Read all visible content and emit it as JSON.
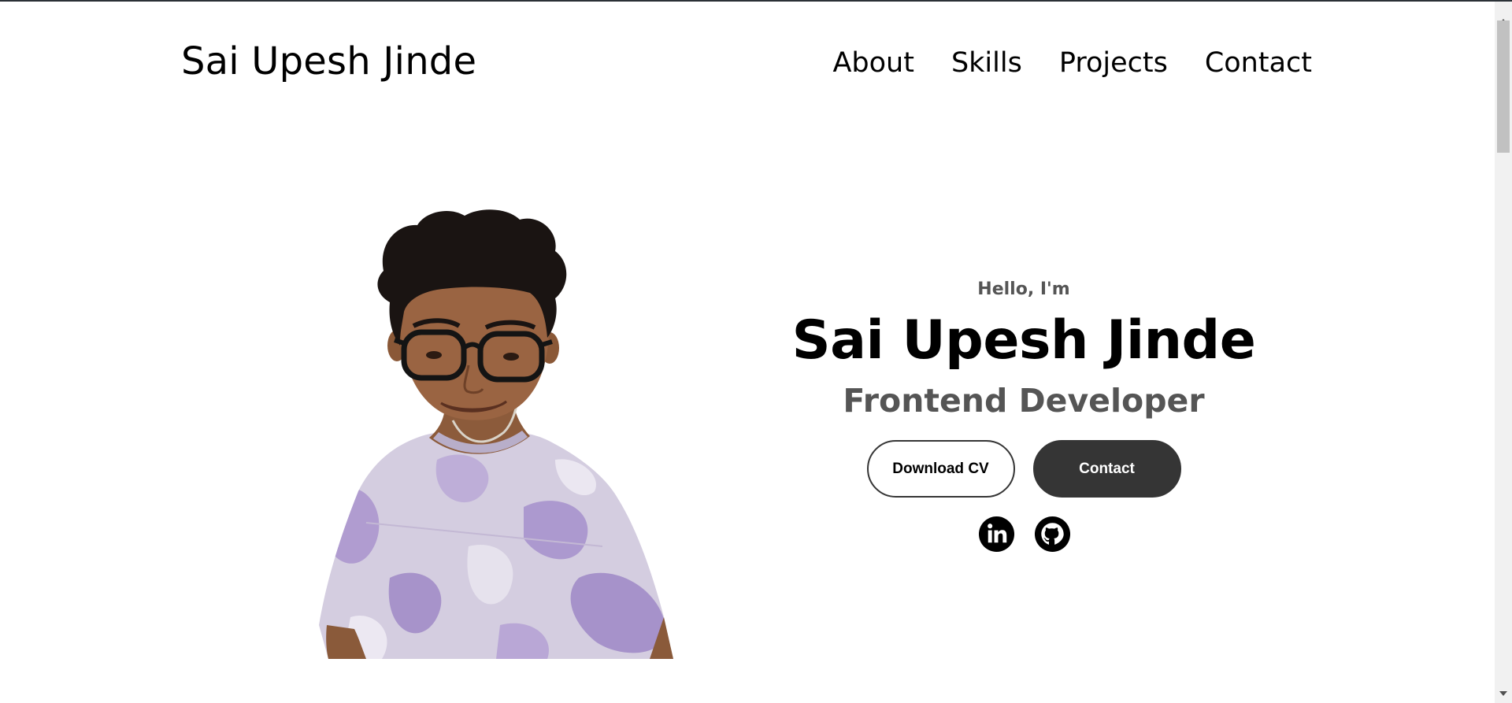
{
  "nav": {
    "logo": "Sai Upesh Jinde",
    "links": [
      "About",
      "Skills",
      "Projects",
      "Contact"
    ]
  },
  "hero": {
    "greeting": "Hello, I'm",
    "name": "Sai Upesh Jinde",
    "role": "Frontend Developer",
    "buttons": {
      "download_cv": "Download CV",
      "contact": "Contact"
    },
    "socials": [
      "linkedin-icon",
      "github-icon"
    ]
  },
  "colors": {
    "text": "#000000",
    "muted": "#555555",
    "button_dark": "#353535",
    "shirt": "#b9a8d2"
  }
}
